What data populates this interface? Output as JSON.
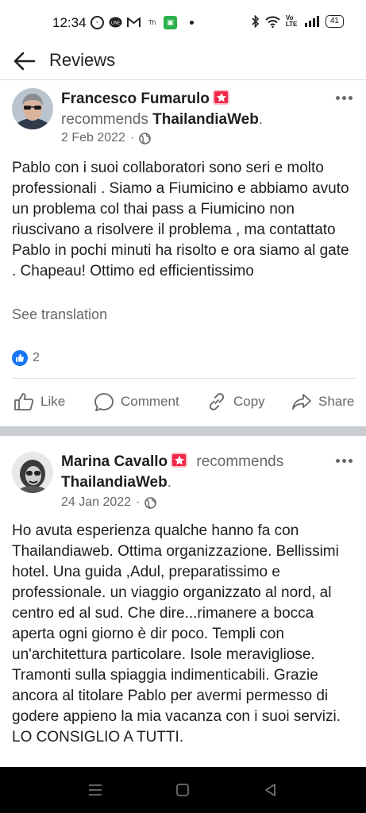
{
  "status_bar": {
    "time": "12:34",
    "icons": [
      "whatsapp-icon",
      "line-icon",
      "gmail-icon",
      "thai-icon",
      "green-app-icon"
    ],
    "network": "Vo LTE",
    "battery": "41"
  },
  "header": {
    "title": "Reviews"
  },
  "reviews": [
    {
      "author": "Francesco Fumarulo",
      "verb": "recommends",
      "page": "ThailandiaWeb",
      "date": "2 Feb 2022",
      "text": "Pablo con i suoi collaboratori sono seri e molto professionali . Siamo a Fiumicino e abbiamo avuto un problema col thai pass  a Fiumicino non riuscivano a risolvere il problema , ma contattato Pablo in pochi minuti ha risolto e ora siamo al gate . Chapeau! Ottimo ed efficientissimo",
      "see_translation": "See translation",
      "like_count": "2",
      "actions": {
        "like": "Like",
        "comment": "Comment",
        "copy": "Copy",
        "share": "Share"
      }
    },
    {
      "author": "Marina Cavallo",
      "verb": "recommends",
      "page": "ThailandiaWeb",
      "date": "24 Jan 2022",
      "text": "Ho avuta esperienza qualche hanno fa con Thailandiaweb. Ottima organizzazione. Bellissimi hotel. Una guida ,Adul, preparatissimo e professionale. un viaggio organizzato al nord, al centro ed al sud. Che dire...rimanere a bocca aperta ogni giorno è dir poco. Templi con un'architettura particolare. Isole meravigliose. Tramonti sulla spiaggia indimenticabili. Grazie ancora al titolare Pablo per avermi permesso di godere appieno la mia vacanza con i suoi servizi. LO CONSIGLIO A TUTTI."
    }
  ],
  "colors": {
    "accent": "#1877f2",
    "badge": "#f02849",
    "secondary_text": "#65676b"
  }
}
